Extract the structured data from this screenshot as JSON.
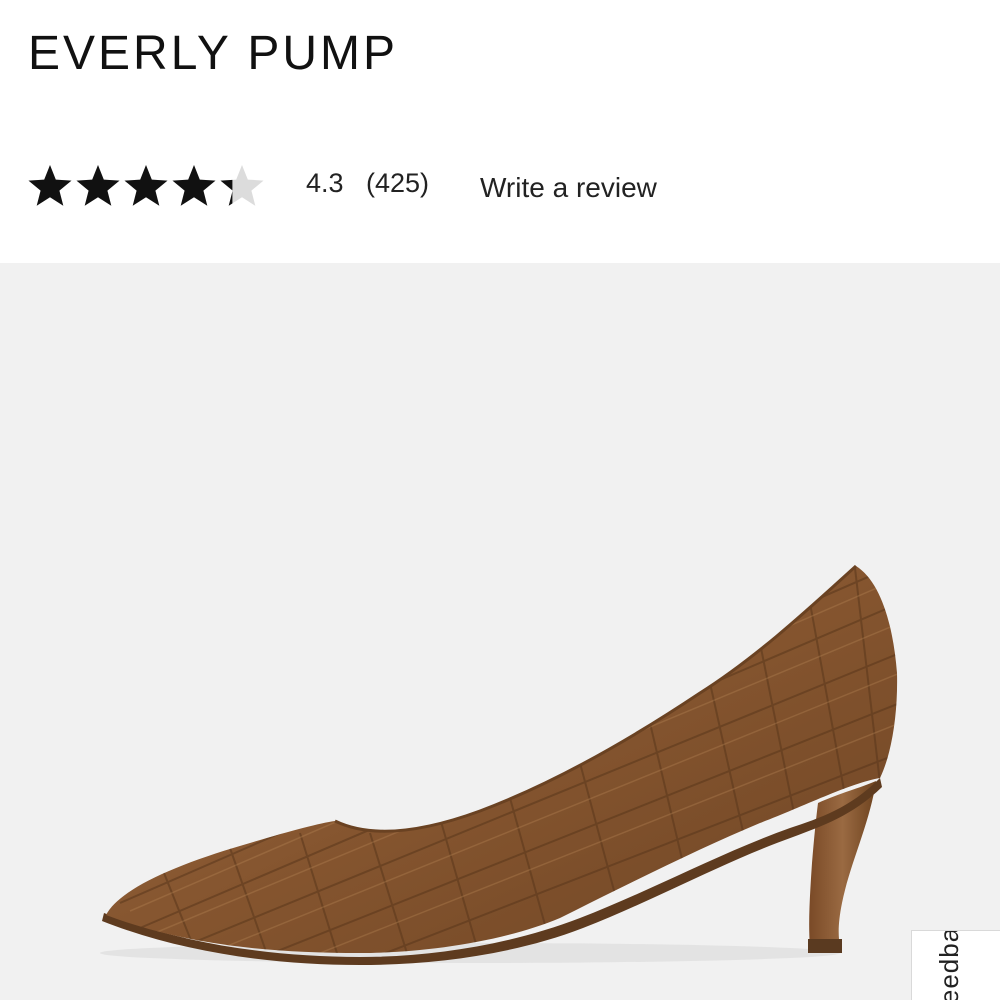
{
  "product": {
    "title": "EVERLY PUMP"
  },
  "rating": {
    "value": "4.3",
    "count": "(425)",
    "stars_filled_fraction": 0.86,
    "stars_total": 5,
    "write_review_label": "Write a review"
  },
  "image": {
    "description_icon": "shoe-image",
    "background_color": "#f1f1f1",
    "shoe_color": "#8a5a34"
  },
  "feedback": {
    "label": "Feedback"
  },
  "colors": {
    "star_filled": "#111111",
    "star_empty": "#dcdcdc",
    "text": "#222222"
  }
}
